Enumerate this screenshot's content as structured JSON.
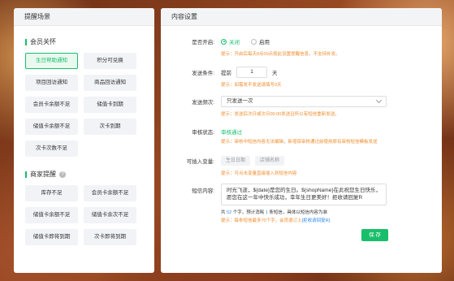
{
  "left": {
    "header": "提醒场景",
    "member_section": "会员关怀",
    "member_buttons": [
      "生日帮助通知",
      "积分可兑换",
      "项目回访通知",
      "商品回访通知",
      "会员卡余额不足",
      "储值卡到期",
      "储值卡余额不足",
      "次卡到期",
      "次卡次数不足"
    ],
    "merchant_section": "商家提醒",
    "merchant_buttons": [
      "库存不足",
      "会员卡余额不足",
      "储值卡余额不足",
      "储值卡余次不足",
      "储值卡即将到期",
      "次卡即将到期"
    ]
  },
  "right": {
    "header": "内容设置",
    "enable": {
      "label": "是否开启:",
      "opt_off": "关闭",
      "opt_on": "启用",
      "hint": "提示：开启后每天8点00点按此设置提醒信息，不支持补发。"
    },
    "condition": {
      "label": "发送条件:",
      "prefix": "提前",
      "value": "1",
      "unit": "天",
      "hint": "提示：如需发不发送请填写0天"
    },
    "frequency": {
      "label": "发送频次:",
      "value": "只发送一次",
      "hint": "提示：发送后次日或次日00:00发送且所以有短信重新发送。"
    },
    "audit": {
      "label": "审核状态:",
      "value": "审核通过",
      "hint": "提示：审核中短信内容无法编辑，新增保审核通过前使用原有审核短信模板发送"
    },
    "vars": {
      "label": "可插入变量:",
      "tags": [
        "生日日期",
        "店铺名称"
      ],
      "hint": "提示：可点击变量直接插入到短信内容"
    },
    "sms": {
      "label": "短信内容:",
      "content": "时光飞逝，${date}是您的生日。${shopName}在此祝您生日快乐，愿您在这一年中快乐成功，幸年生日更美好！拒收请回复R",
      "count_pre": "共",
      "count_chars": "52",
      "count_mid": "个字，预计消耗",
      "count_msgs": "1",
      "count_post": "条短信，具体以短信内容为准",
      "hint_pre": "提示：每条短信最多70个字，会员退订上",
      "hint_link": "[拒收请回复R]"
    },
    "save_label": "保 存"
  },
  "colors": {
    "accent": "#19be6b",
    "warning": "#f08c2b",
    "link": "#2d8cf0"
  }
}
